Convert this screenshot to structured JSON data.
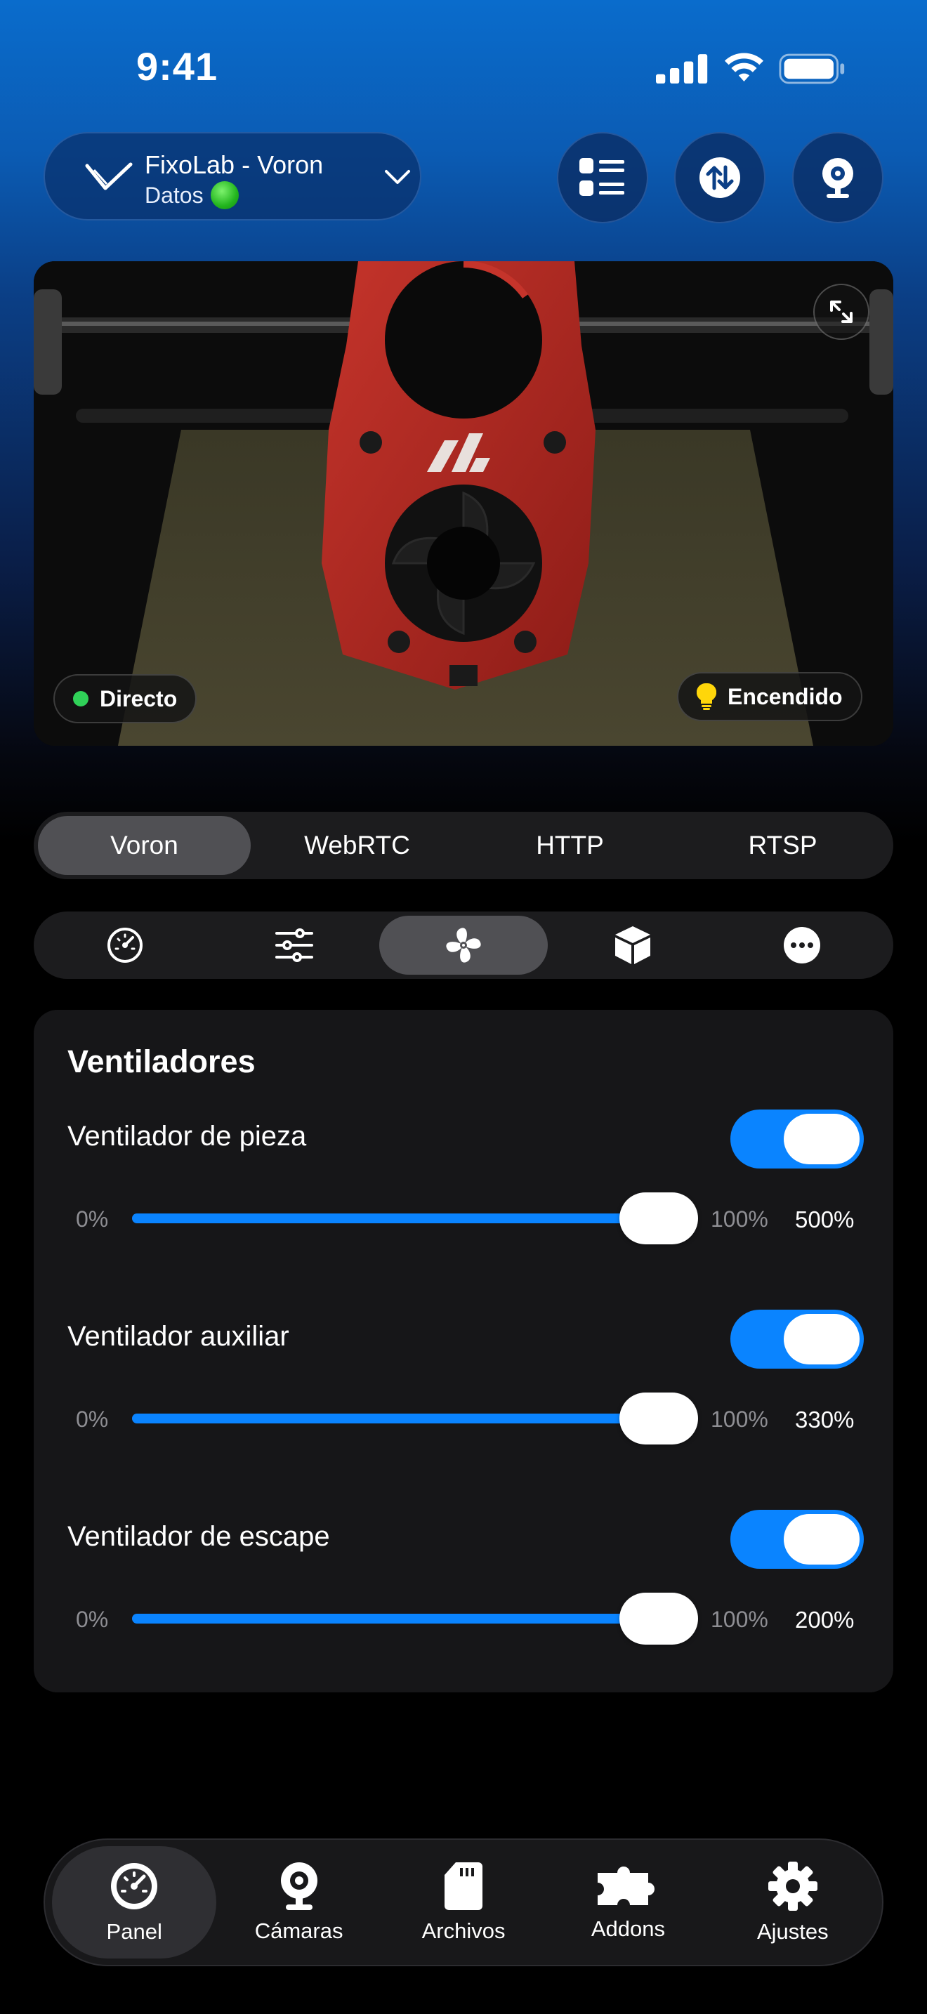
{
  "status_bar": {
    "time": "9:41"
  },
  "header": {
    "printer_name": "FixoLab - Voron",
    "printer_status": "Datos",
    "buttons": [
      "list-icon",
      "transfer-icon",
      "webcam-icon"
    ]
  },
  "camera": {
    "live_label": "Directo",
    "light_label": "Encendido",
    "colors": {
      "live_dot": "#30d158",
      "bulb": "#ffd60a"
    }
  },
  "stream_tabs": [
    {
      "label": "Voron",
      "active": true
    },
    {
      "label": "WebRTC",
      "active": false
    },
    {
      "label": "HTTP",
      "active": false
    },
    {
      "label": "RTSP",
      "active": false
    }
  ],
  "section_tabs": [
    {
      "icon": "gauge-icon",
      "active": false
    },
    {
      "icon": "sliders-icon",
      "active": false
    },
    {
      "icon": "fan-icon",
      "active": true
    },
    {
      "icon": "box-icon",
      "active": false
    },
    {
      "icon": "more-icon",
      "active": false
    }
  ],
  "fans": {
    "title": "Ventiladores",
    "items": [
      {
        "label": "Ventilador de pieza",
        "enabled": true,
        "min": "0%",
        "max": "100%",
        "value": "500%",
        "slider_fraction": 1.0
      },
      {
        "label": "Ventilador auxiliar",
        "enabled": true,
        "min": "0%",
        "max": "100%",
        "value": "330%",
        "slider_fraction": 1.0
      },
      {
        "label": "Ventilador de escape",
        "enabled": true,
        "min": "0%",
        "max": "100%",
        "value": "200%",
        "slider_fraction": 1.0
      }
    ]
  },
  "tabbar": [
    {
      "label": "Panel",
      "icon": "dashboard-icon",
      "active": true
    },
    {
      "label": "Cámaras",
      "icon": "camera-icon",
      "active": false
    },
    {
      "label": "Archivos",
      "icon": "sd-card-icon",
      "active": false
    },
    {
      "label": "Addons",
      "icon": "puzzle-icon",
      "active": false
    },
    {
      "label": "Ajustes",
      "icon": "gear-icon",
      "active": false
    }
  ],
  "accent_color": "#0a84ff"
}
